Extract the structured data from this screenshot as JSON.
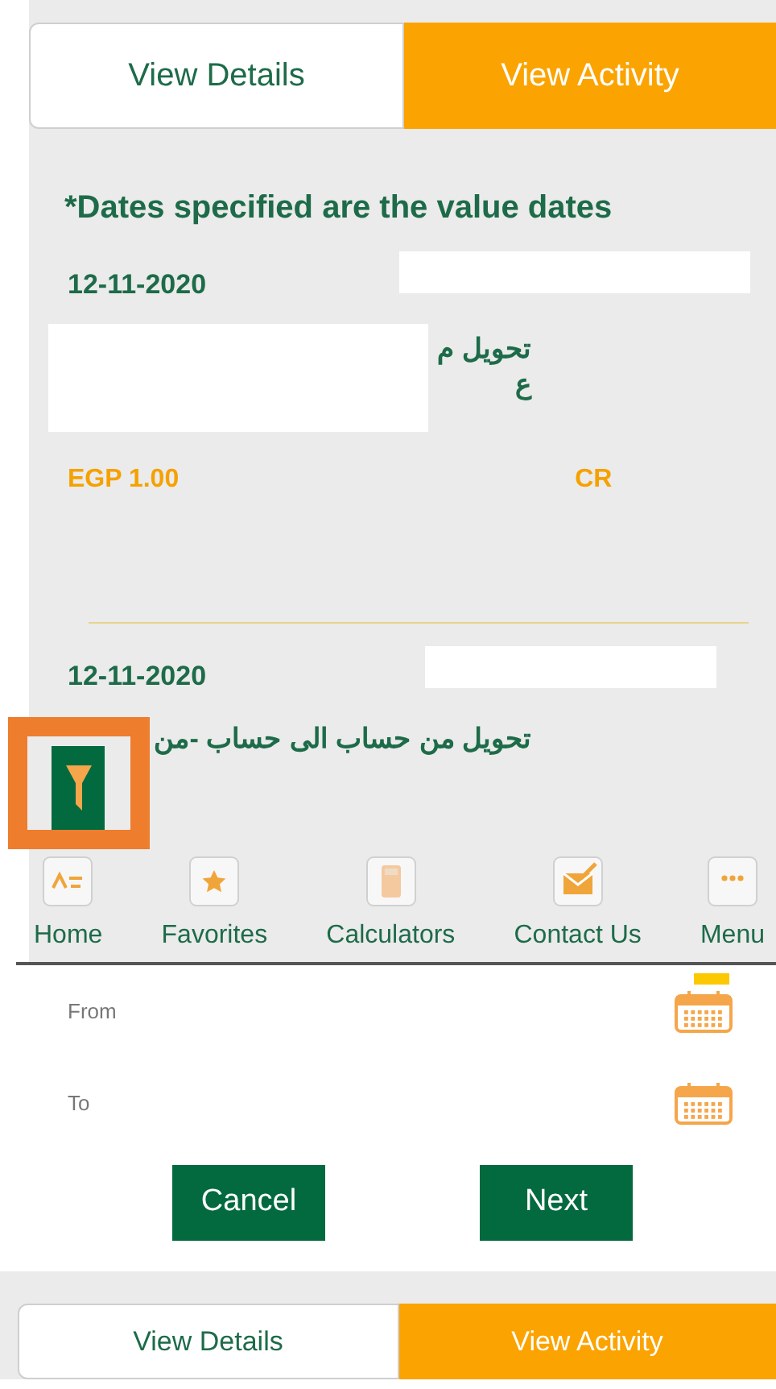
{
  "top_tabs": [
    {
      "label": "View Details",
      "selected": false
    },
    {
      "label": "View Activity",
      "selected": true
    }
  ],
  "note": "*Dates specified are the value dates",
  "transactions": [
    {
      "date": "12-11-2020",
      "description_lines": [
        "تحويل م",
        "ع"
      ],
      "amount": "EGP 1.00",
      "type": "CR"
    },
    {
      "date": "12-11-2020",
      "description_lines": [
        "تحويل من حساب الى حساب -من"
      ]
    }
  ],
  "bottom_nav": [
    {
      "label": "Home",
      "kind": "home"
    },
    {
      "label": "Favorites",
      "kind": "star"
    },
    {
      "label": "Calculators",
      "kind": "calculator"
    },
    {
      "label": "Contact Us",
      "kind": "mail"
    },
    {
      "label": "Menu",
      "kind": "more"
    }
  ],
  "date_filter": [
    {
      "label": "From"
    },
    {
      "label": "To"
    }
  ],
  "buttons": [
    "Cancel",
    "Next"
  ],
  "bottom_tabs": [
    {
      "label": "View Details",
      "selected": false
    },
    {
      "label": "View Activity",
      "selected": true
    }
  ]
}
